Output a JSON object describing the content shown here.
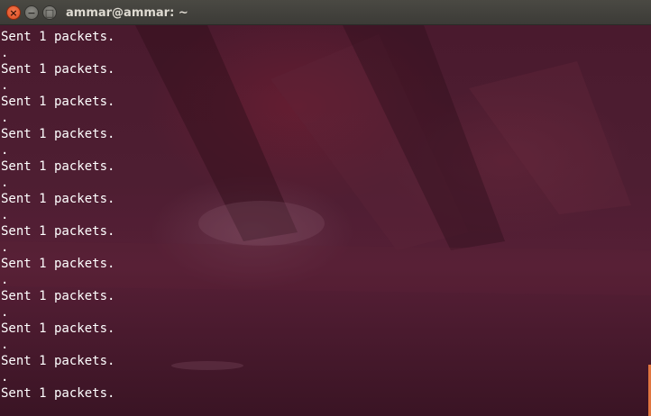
{
  "window": {
    "title": "ammar@ammar: ~",
    "buttons": {
      "close_glyph": "×",
      "minimize_glyph": "−",
      "maximize_glyph": "□"
    }
  },
  "terminal": {
    "lines": [
      "Sent 1 packets.",
      ".",
      "Sent 1 packets.",
      ".",
      "Sent 1 packets.",
      ".",
      "Sent 1 packets.",
      ".",
      "Sent 1 packets.",
      ".",
      "Sent 1 packets.",
      ".",
      "Sent 1 packets.",
      ".",
      "Sent 1 packets.",
      ".",
      "Sent 1 packets.",
      ".",
      "Sent 1 packets.",
      ".",
      "Sent 1 packets.",
      ".",
      "Sent 1 packets."
    ],
    "text_color": "#ffffff",
    "background_color": "#4e1e32",
    "scroll_marker_color": "#e0753f"
  }
}
